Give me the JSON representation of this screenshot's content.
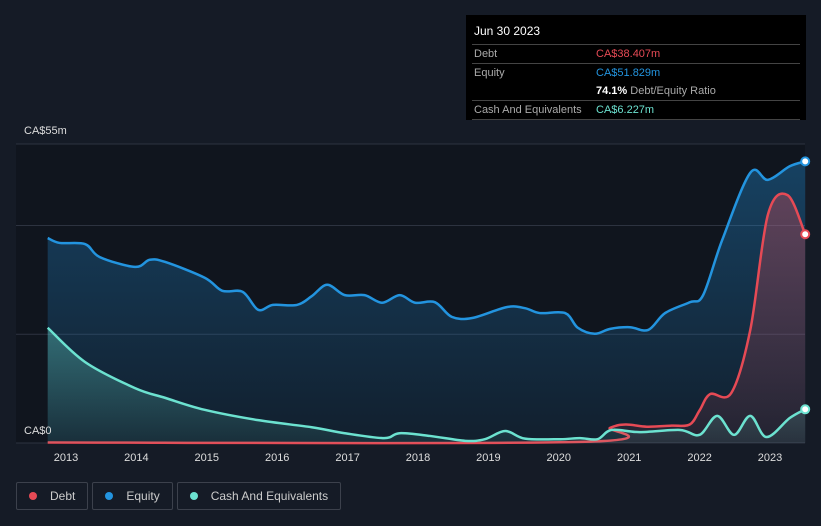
{
  "tooltip": {
    "date": "Jun 30 2023",
    "debt_label": "Debt",
    "debt_value": "CA$38.407m",
    "equity_label": "Equity",
    "equity_value": "CA$51.829m",
    "ratio_value": "74.1%",
    "ratio_label": "Debt/Equity Ratio",
    "cash_label": "Cash And Equivalents",
    "cash_value": "CA$6.227m"
  },
  "legend": [
    "Debt",
    "Equity",
    "Cash And Equivalents"
  ],
  "colors": {
    "debt": "#e64a55",
    "equity": "#2394df",
    "cash": "#6ce2d0"
  },
  "chart_data": {
    "type": "area",
    "ylim": [
      0,
      55
    ],
    "y_tick_labels": [
      "CA$0",
      "CA$55m"
    ],
    "x_tick_labels": [
      "2013",
      "2014",
      "2015",
      "2016",
      "2017",
      "2018",
      "2019",
      "2020",
      "2021",
      "2022",
      "2023"
    ],
    "grid": true,
    "legend_position": "bottom-left",
    "series": [
      {
        "name": "Equity",
        "points": [
          [
            2012.74,
            37.7
          ],
          [
            2012.91,
            36.8
          ],
          [
            2013.27,
            36.6
          ],
          [
            2013.48,
            34.2
          ],
          [
            2013.98,
            32.4
          ],
          [
            2014.19,
            33.7
          ],
          [
            2014.41,
            33.3
          ],
          [
            2014.97,
            30.4
          ],
          [
            2015.22,
            28.0
          ],
          [
            2015.51,
            27.8
          ],
          [
            2015.73,
            24.5
          ],
          [
            2015.94,
            25.4
          ],
          [
            2016.28,
            25.4
          ],
          [
            2016.49,
            27.0
          ],
          [
            2016.71,
            29.1
          ],
          [
            2016.96,
            27.2
          ],
          [
            2017.24,
            27.2
          ],
          [
            2017.49,
            25.8
          ],
          [
            2017.74,
            27.2
          ],
          [
            2017.96,
            25.8
          ],
          [
            2018.24,
            25.9
          ],
          [
            2018.48,
            23.2
          ],
          [
            2018.77,
            23.0
          ],
          [
            2019.26,
            25.0
          ],
          [
            2019.52,
            24.8
          ],
          [
            2019.73,
            23.9
          ],
          [
            2020.09,
            23.9
          ],
          [
            2020.27,
            21.2
          ],
          [
            2020.51,
            20.1
          ],
          [
            2020.73,
            21.0
          ],
          [
            2021.01,
            21.3
          ],
          [
            2021.27,
            20.8
          ],
          [
            2021.51,
            23.9
          ],
          [
            2021.86,
            25.9
          ],
          [
            2022.05,
            27.2
          ],
          [
            2022.32,
            37.3
          ],
          [
            2022.72,
            49.7
          ],
          [
            2022.97,
            48.4
          ],
          [
            2023.28,
            50.9
          ],
          [
            2023.5,
            51.8
          ]
        ]
      },
      {
        "name": "Debt",
        "points": [
          [
            2012.74,
            0.1
          ],
          [
            2020.3,
            0.2
          ],
          [
            2020.73,
            2.8
          ],
          [
            2020.95,
            3.4
          ],
          [
            2021.25,
            3.0
          ],
          [
            2021.6,
            3.2
          ],
          [
            2021.86,
            3.4
          ],
          [
            2022.0,
            6.0
          ],
          [
            2022.15,
            9.0
          ],
          [
            2022.45,
            9.2
          ],
          [
            2022.72,
            20.8
          ],
          [
            2022.97,
            42.0
          ],
          [
            2023.25,
            45.6
          ],
          [
            2023.5,
            38.4
          ]
        ]
      },
      {
        "name": "Cash And Equivalents",
        "points": [
          [
            2012.74,
            21.2
          ],
          [
            2013.27,
            14.9
          ],
          [
            2013.98,
            10.1
          ],
          [
            2014.41,
            8.3
          ],
          [
            2014.97,
            6.1
          ],
          [
            2015.73,
            4.2
          ],
          [
            2016.49,
            2.9
          ],
          [
            2016.96,
            1.8
          ],
          [
            2017.52,
            0.9
          ],
          [
            2017.74,
            1.8
          ],
          [
            2018.17,
            1.3
          ],
          [
            2018.67,
            0.4
          ],
          [
            2018.95,
            0.7
          ],
          [
            2019.24,
            2.2
          ],
          [
            2019.52,
            0.8
          ],
          [
            2020.02,
            0.7
          ],
          [
            2020.3,
            0.9
          ],
          [
            2020.55,
            0.7
          ],
          [
            2020.75,
            2.4
          ],
          [
            2021.15,
            2.0
          ],
          [
            2021.72,
            2.4
          ],
          [
            2022.0,
            1.5
          ],
          [
            2022.25,
            5.0
          ],
          [
            2022.49,
            1.5
          ],
          [
            2022.72,
            5.0
          ],
          [
            2022.95,
            1.1
          ],
          [
            2023.28,
            4.6
          ],
          [
            2023.5,
            6.2
          ]
        ]
      }
    ]
  }
}
